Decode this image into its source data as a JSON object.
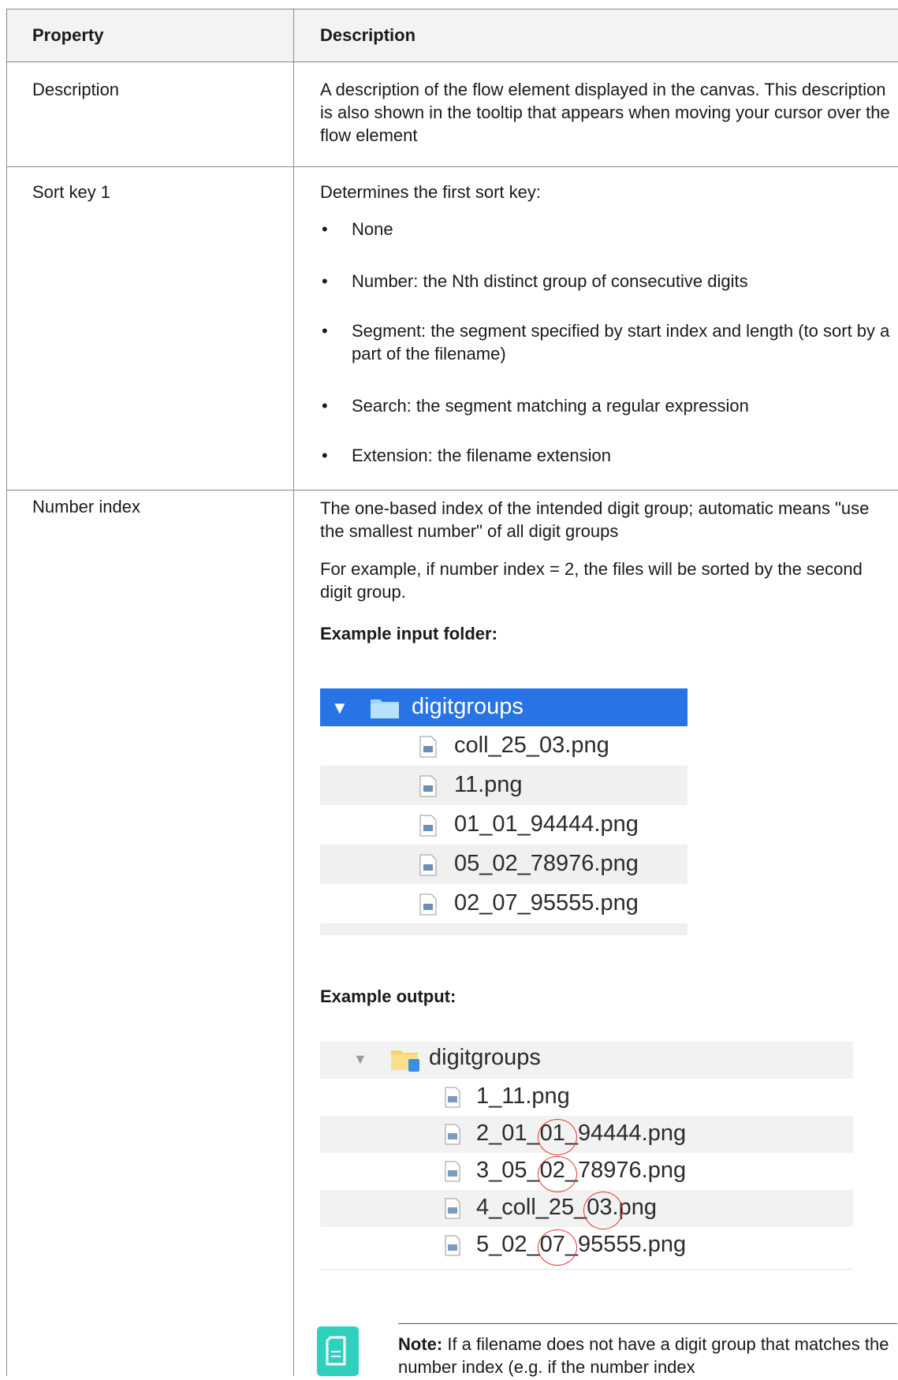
{
  "table": {
    "header": {
      "property": "Property",
      "description": "Description"
    },
    "rows": [
      {
        "property": "Description",
        "description": "A description of the flow element displayed in the canvas. This description is also shown in the tooltip that appears when moving your cursor over the flow element"
      },
      {
        "property": "Sort key 1",
        "intro": "Determines the first sort key:",
        "options": [
          "None",
          "Number: the Nth distinct group of consecutive digits",
          "Segment: the segment specified by start index and length (to sort by a part of the filename)",
          "Search: the segment matching a regular expression",
          "Extension: the filename extension"
        ]
      },
      {
        "property": "Number index",
        "para1": "The one-based index of the intended digit group; automatic means \"use the smallest number\" of all digit groups",
        "para2": "For example, if number index = 2, the files will be sorted by the second digit group.",
        "input_heading": "Example input folder:",
        "output_heading": "Example output:",
        "note_label": "Note:",
        "note_text": " If a filename does not have a digit group that matches the number index (e.g. if the number index"
      }
    ]
  },
  "input_folder": {
    "name": "digitgroups",
    "files": [
      "coll_25_03.png",
      "11.png",
      "01_01_94444.png",
      "05_02_78976.png",
      "02_07_95555.png"
    ]
  },
  "output_folder": {
    "name": "digitgroups",
    "files": [
      "1_11.png",
      "2_01_01_94444.png",
      "3_05_02_78976.png",
      "4_coll_25_03.png",
      "5_02_07_95555.png"
    ]
  },
  "colors": {
    "selection": "#2873e6",
    "note_icon": "#2fd1be",
    "highlight_circle": "#e0392f"
  }
}
